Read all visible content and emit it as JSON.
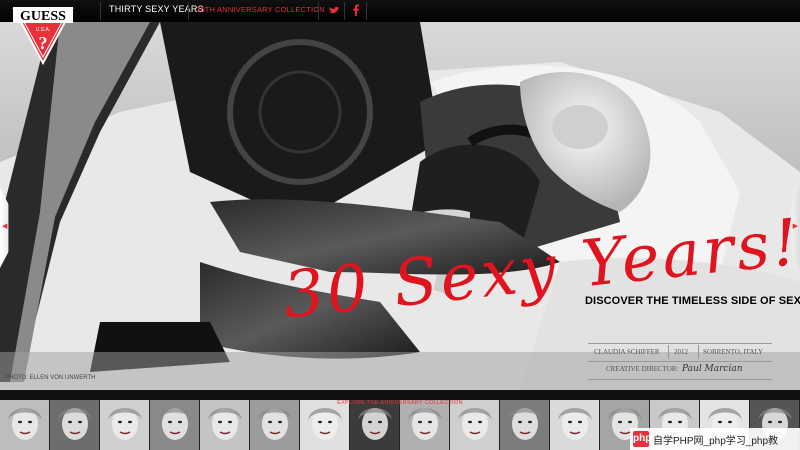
{
  "brand": {
    "name": "GUESS",
    "sub": "U.S.A.",
    "mark": "?"
  },
  "nav": {
    "thirty_sexy_years": "THIRTY SEXY YEARS",
    "anniversary_collection": "30TH ANNIVERSARY COLLECTION",
    "social": [
      "twitter-icon",
      "facebook-icon"
    ]
  },
  "hero": {
    "script_title": "30 Sexy Years!",
    "tagline": "DISCOVER THE TIMELESS SIDE OF SEXY",
    "credits": {
      "model": "CLAUDIA SCHIFFER",
      "year": "2012",
      "location": "SORRENTO, ITALY",
      "director_label": "CREATIVE DIRECTOR:",
      "director_signature": "Paul Marciano"
    },
    "photo_credit": "PHOTO: ELLEN VON UNWERTH"
  },
  "strip": {
    "explore_label": "EXPLORE THE ANNIVERSARY COLLECTION",
    "thumbnails": [
      "1",
      "2",
      "3",
      "4",
      "5",
      "6",
      "7",
      "8",
      "9",
      "10",
      "11",
      "12",
      "13",
      "14",
      "15",
      "16"
    ]
  },
  "watermark": {
    "badge": "php",
    "text": "自学PHP网_php学习_php教"
  },
  "colors": {
    "accent": "#e8303b",
    "bg": "#000000"
  }
}
